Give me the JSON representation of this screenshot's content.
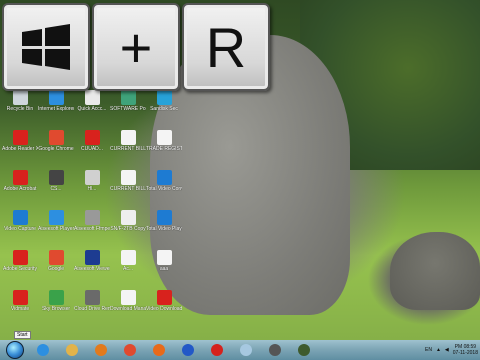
{
  "overlay_keys": [
    {
      "label": "",
      "icon": "windows-logo-icon"
    },
    {
      "label": "+"
    },
    {
      "label": "R"
    }
  ],
  "desktop_icons": [
    {
      "label": "Recycle Bin",
      "icon": "recycle-bin-icon",
      "color": "#cfd6dc"
    },
    {
      "label": "Internet Explorer",
      "icon": "internet-explorer-icon",
      "color": "#2d8fe0"
    },
    {
      "label": "Quick Accc...",
      "icon": "folder-icon",
      "color": "#e9e9e9"
    },
    {
      "label": "SOFTWARE Portable Exe",
      "icon": "software-icon",
      "color": "#3fa37a"
    },
    {
      "label": "Sandisk Sec",
      "icon": "app-icon",
      "color": "#27a2d8"
    },
    {
      "label": "Adobe Reader XI",
      "icon": "adobe-reader-icon",
      "color": "#d8221d"
    },
    {
      "label": "Google Chrome",
      "icon": "chrome-icon",
      "color": "#e04a2f"
    },
    {
      "label": "CUUAD...",
      "icon": "document-icon",
      "color": "#d8221d"
    },
    {
      "label": "CURRENT BILL NO.",
      "icon": "document-icon",
      "color": "#f4f4f4"
    },
    {
      "label": "TRADE REGISTER",
      "icon": "document-icon",
      "color": "#f4f4f4"
    },
    {
      "label": "Adobe Acrobat",
      "icon": "adobe-icon",
      "color": "#d8221d"
    },
    {
      "label": "CS...",
      "icon": "app-icon",
      "color": "#444"
    },
    {
      "label": "Hl...",
      "icon": "document-icon",
      "color": "#d0d0d0"
    },
    {
      "label": "CURRENT BILL NO.2018",
      "icon": "document-icon",
      "color": "#f4f4f4"
    },
    {
      "label": "Total Video Converter",
      "icon": "video-converter-icon",
      "color": "#1e7bd2"
    },
    {
      "label": "Video Capture",
      "icon": "app-icon",
      "color": "#1e7bd2"
    },
    {
      "label": "Aiseesoft Player",
      "icon": "app-icon",
      "color": "#2d8fe0"
    },
    {
      "label": "Aiseesoft Ffmpeg Edit",
      "icon": "app-icon",
      "color": "#999"
    },
    {
      "label": "SN/F-2TB Copy",
      "icon": "document-icon",
      "color": "#eee"
    },
    {
      "label": "Total Video Player",
      "icon": "video-player-icon",
      "color": "#1e7bd2"
    },
    {
      "label": "Adobe Security",
      "icon": "app-icon",
      "color": "#d8221d"
    },
    {
      "label": "Google",
      "icon": "chrome-icon",
      "color": "#e04a2f"
    },
    {
      "label": "Aiseesoft Viewer",
      "icon": "app-icon",
      "color": "#1d3c91"
    },
    {
      "label": "Ac...",
      "icon": "document-icon",
      "color": "#f4f4f4"
    },
    {
      "label": "aaa",
      "icon": "document-icon",
      "color": "#f4f4f4"
    },
    {
      "label": "Vidmate",
      "icon": "app-icon",
      "color": "#d8221d"
    },
    {
      "label": "Sky Browser",
      "icon": "app-icon",
      "color": "#3aa24a"
    },
    {
      "label": "Cloud Drive Rent",
      "icon": "app-icon",
      "color": "#6a6a6a"
    },
    {
      "label": "Download Manager",
      "icon": "document-icon",
      "color": "#f4f4f4"
    },
    {
      "label": "Video Downloader",
      "icon": "app-icon",
      "color": "#d8221d"
    }
  ],
  "start_tooltip": "Start",
  "taskbar_items": [
    {
      "icon": "internet-explorer-icon",
      "color": "#2d8fe0"
    },
    {
      "icon": "file-explorer-icon",
      "color": "#e2b34a"
    },
    {
      "icon": "media-player-icon",
      "color": "#e27a1d"
    },
    {
      "icon": "chrome-icon",
      "color": "#e04a2f"
    },
    {
      "icon": "firefox-icon",
      "color": "#e86a1a"
    },
    {
      "icon": "app-icon",
      "color": "#2258c7"
    },
    {
      "icon": "opera-icon",
      "color": "#d5221d"
    },
    {
      "icon": "window-icon",
      "color": "#a6c8e0"
    },
    {
      "icon": "app-icon",
      "color": "#555"
    },
    {
      "icon": "app-icon",
      "color": "#3e5b2e"
    }
  ],
  "tray": {
    "language": "EN",
    "time": "PM 08:59",
    "date": "07-11-2018"
  }
}
